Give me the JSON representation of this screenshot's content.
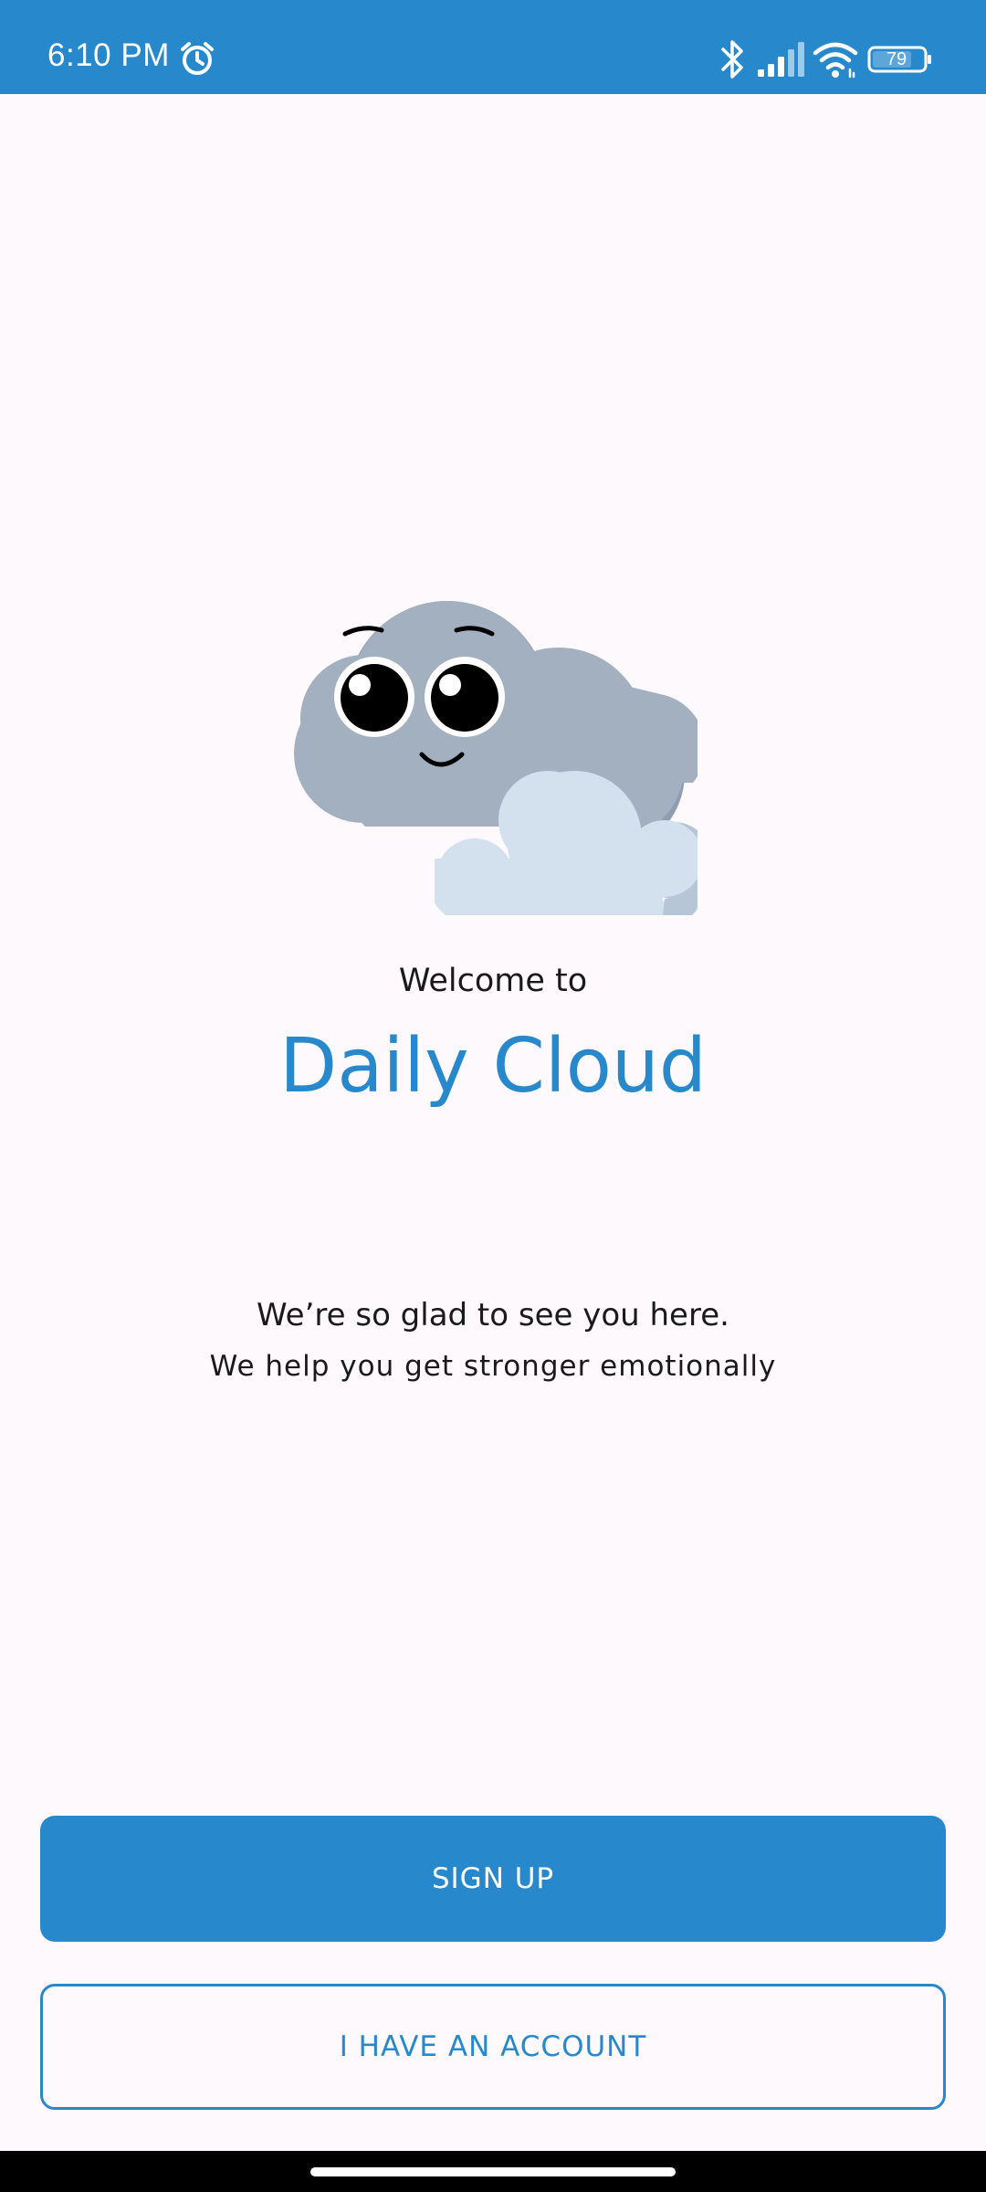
{
  "status_bar": {
    "time": "6:10 PM",
    "battery": "79",
    "icons": [
      "alarm-icon",
      "bluetooth-icon",
      "signal-icon",
      "wifi-icon",
      "battery-icon"
    ]
  },
  "welcome": {
    "greeting": "Welcome to",
    "app_name": "Daily Cloud",
    "tagline_primary": "We’re so glad to see you here.",
    "tagline_secondary": "We help you get stronger emotionally"
  },
  "actions": {
    "sign_up_label": "SIGN UP",
    "have_account_label": "I HAVE AN ACCOUNT"
  },
  "colors": {
    "accent": "#2789cc",
    "background": "#fdf9fc",
    "text": "#1a1a1a"
  }
}
